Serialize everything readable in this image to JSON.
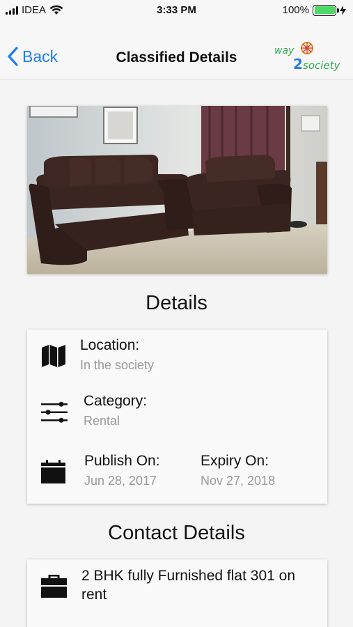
{
  "status_bar": {
    "carrier": "IDEA",
    "time": "3:33 PM",
    "battery": "100%"
  },
  "nav": {
    "back_label": "Back",
    "title": "Classified Details",
    "logo_text_top": "way",
    "logo_text_bottom": "society",
    "logo_number": "2"
  },
  "details": {
    "heading": "Details",
    "location_label": "Location:",
    "location_value": "In the society",
    "category_label": "Category:",
    "category_value": "Rental",
    "publish_label": "Publish On:",
    "publish_value": "Jun 28, 2017",
    "expiry_label": "Expiry On:",
    "expiry_value": "Nov 27, 2018"
  },
  "contact": {
    "heading": "Contact Details",
    "listing_title": "2 BHK fully Furnished flat 301 on rent"
  },
  "colors": {
    "accent": "#1a7ef7",
    "battery": "#4cd964"
  }
}
